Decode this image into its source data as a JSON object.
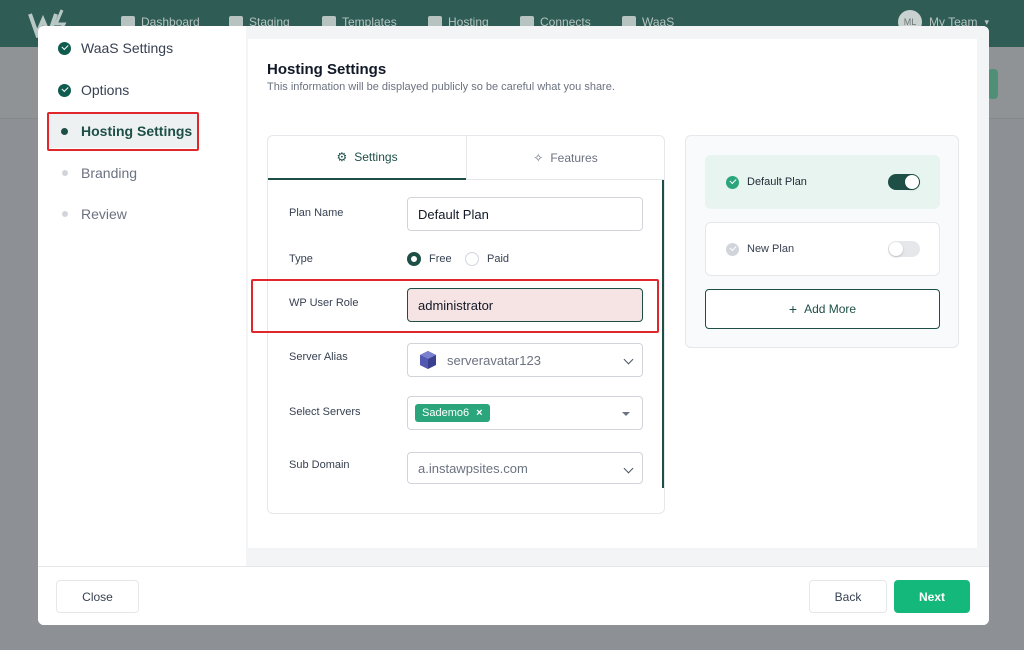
{
  "background": {
    "nav": [
      {
        "label": "Dashboard",
        "icon": "home-icon"
      },
      {
        "label": "Staging",
        "icon": "cube-icon"
      },
      {
        "label": "Templates",
        "icon": "template-icon"
      },
      {
        "label": "Hosting",
        "icon": "cloud-icon"
      },
      {
        "label": "Connects",
        "icon": "link-icon"
      },
      {
        "label": "WaaS",
        "icon": "cloud-icon"
      }
    ],
    "team_label": "My Team",
    "avatar_initials": "ML"
  },
  "steps": [
    {
      "label": "WaaS Settings",
      "state": "done"
    },
    {
      "label": "Options",
      "state": "done"
    },
    {
      "label": "Hosting Settings",
      "state": "current"
    },
    {
      "label": "Branding",
      "state": "pending"
    },
    {
      "label": "Review",
      "state": "pending"
    }
  ],
  "header": {
    "title": "Hosting Settings",
    "subtitle": "This information will be displayed publicly so be careful what you share."
  },
  "tabs": {
    "settings": "Settings",
    "features": "Features"
  },
  "form": {
    "plan_name_label": "Plan Name",
    "plan_name_value": "Default Plan",
    "type_label": "Type",
    "type_options": [
      "Free",
      "Paid"
    ],
    "type_selected": "Free",
    "wp_role_label": "WP User Role",
    "wp_role_value": "administrator",
    "server_alias_label": "Server Alias",
    "server_alias_value": "serveravatar123",
    "select_servers_label": "Select Servers",
    "selected_server_tag": "Sademo6",
    "tag_remove": "×",
    "sub_domain_label": "Sub Domain",
    "sub_domain_value": "a.instawpsites.com"
  },
  "plans": {
    "items": [
      {
        "name": "Default Plan",
        "enabled": true
      },
      {
        "name": "New Plan",
        "enabled": false
      }
    ],
    "add_more_icon": "+",
    "add_more_label": "Add More"
  },
  "footer": {
    "close_label": "Close",
    "back_label": "Back",
    "next_label": "Next"
  },
  "colors": {
    "primary": "#1d4f47",
    "accent": "#14b87a",
    "tag": "#2ba57b",
    "highlight": "#e0272c"
  }
}
